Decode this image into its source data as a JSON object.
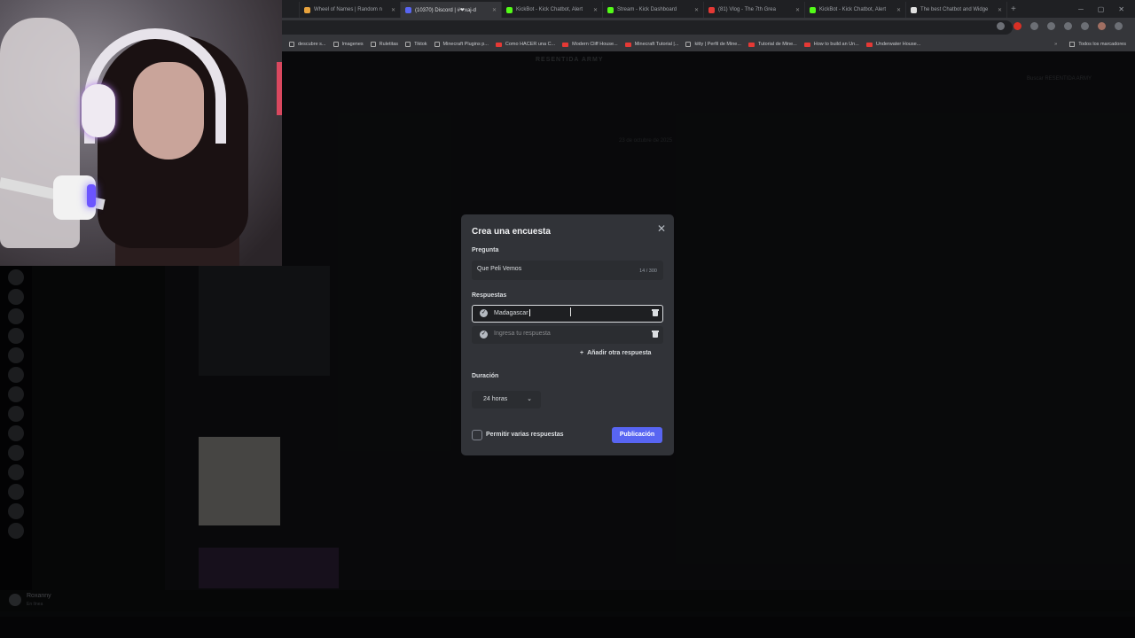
{
  "browser": {
    "tabs": [
      {
        "title": "Wheel of Names | Random n",
        "color": "#e8a33d"
      },
      {
        "title": "(10370) Discord | #❤xaj-d",
        "color": "#5865f2"
      },
      {
        "title": "KickBot - Kick Chatbot, Alert",
        "color": "#53fc18"
      },
      {
        "title": "Stream - Kick Dashboard",
        "color": "#53fc18"
      },
      {
        "title": "(81) Vlog - The 7th Grea",
        "color": "#e53935"
      },
      {
        "title": "KickBot - Kick Chatbot, Alert",
        "color": "#53fc18"
      },
      {
        "title": "The best Chatbot and Widge",
        "color": "#e0e0e0"
      }
    ],
    "bookmarks": [
      {
        "label": "descubre s...",
        "type": "folder"
      },
      {
        "label": "Imagenes",
        "type": "folder"
      },
      {
        "label": "Ruletitas",
        "type": "folder"
      },
      {
        "label": "Tiktok",
        "type": "folder"
      },
      {
        "label": "Minecraft Plugins p...",
        "type": "folder"
      },
      {
        "label": "Como HACER una C...",
        "type": "yt"
      },
      {
        "label": "Modern Cliff House...",
        "type": "yt"
      },
      {
        "label": "Minecraft Tutorial |...",
        "type": "yt"
      },
      {
        "label": "kitty | Perfil de Mine...",
        "type": "folder"
      },
      {
        "label": "Tutorial de Mine...",
        "type": "yt"
      },
      {
        "label": "How to build an Un...",
        "type": "yt"
      },
      {
        "label": "Underwater House...",
        "type": "yt"
      }
    ],
    "all_bookmarks": "Todos los marcadores"
  },
  "discord": {
    "server_name": "RESENTIDA ARMY",
    "search_placeholder": "Buscar RESENTIDA ARMY",
    "date_divider": "23 de octubre de 2025",
    "user": {
      "name": "Roxanny",
      "status": "En línea"
    }
  },
  "poll_modal": {
    "title": "Crea una encuesta",
    "question_label": "Pregunta",
    "question_value": "Que Peli Vemos",
    "char_count": "14 / 300",
    "answers_label": "Respuestas",
    "answers": [
      {
        "value": "Madagascar",
        "placeholder": ""
      },
      {
        "value": "",
        "placeholder": "Ingresa tu respuesta"
      }
    ],
    "add_answer": "Añadir otra respuesta",
    "duration_label": "Duración",
    "duration_value": "24 horas",
    "multi_label": "Permitir varias respuestas",
    "multi_checked": false,
    "publish_label": "Publicación"
  },
  "colors": {
    "accent": "#5865f2",
    "modal_bg": "#313338",
    "input_bg": "#2b2d31"
  }
}
